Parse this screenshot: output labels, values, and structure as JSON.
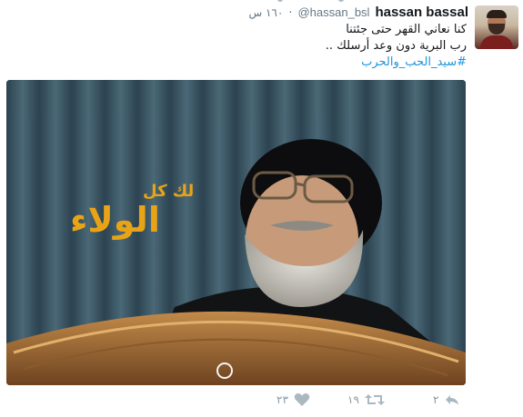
{
  "tweet": {
    "display_name": "hassan bassal",
    "handle": "@hassan_bsl",
    "separator": "·",
    "timestamp": "١٦٠ س",
    "text_lines": [
      "كنا نعاني القهر حتى جئتنا",
      "رب البرية دون وعد أرسلك .."
    ],
    "hashtag": "#سيد_الحب_والحرب"
  },
  "media": {
    "overlay_text_small": "لك كل",
    "overlay_text_large": "الولاء",
    "overlay_color": "#e8a317"
  },
  "actions": {
    "reply_count": "٢",
    "retweet_count": "١٩",
    "like_count": "٢٣"
  },
  "colors": {
    "link": "#1b95e0",
    "muted": "#657786",
    "icon": "#aab8c2"
  }
}
